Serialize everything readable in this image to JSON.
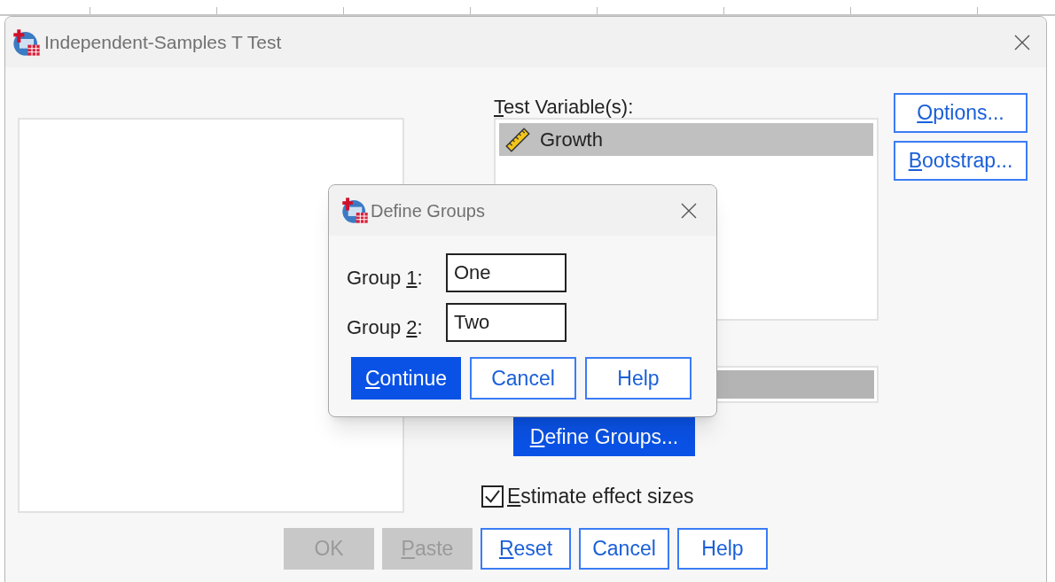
{
  "window": {
    "title": "Independent-Samples T Test"
  },
  "test_variables": {
    "label": {
      "key": "T",
      "post": "est Variable(s):"
    },
    "items": [
      {
        "name": "Growth",
        "selected": true
      }
    ]
  },
  "grouping_variable": {
    "selected": true
  },
  "define_groups_button": {
    "label": {
      "key": "D",
      "post": "efine Groups..."
    },
    "highlighted": true,
    "disabled": false
  },
  "side_buttons": [
    {
      "label": {
        "key": "O",
        "post": "ptions..."
      },
      "highlighted": false,
      "disabled": false
    },
    {
      "label": {
        "key": "B",
        "post": "ootstrap..."
      },
      "highlighted": false,
      "disabled": false
    }
  ],
  "effect_sizes": {
    "label": {
      "key": "E",
      "post": "stimate effect sizes"
    },
    "checked": true
  },
  "bottom_buttons": [
    {
      "label": {
        "pre": "OK"
      },
      "highlighted": false,
      "disabled": true
    },
    {
      "label": {
        "key": "P",
        "post": "aste"
      },
      "highlighted": false,
      "disabled": true
    },
    {
      "label": {
        "key": "R",
        "post": "eset"
      },
      "highlighted": false,
      "disabled": false
    },
    {
      "label": {
        "pre": "Cancel"
      },
      "highlighted": false,
      "disabled": false
    },
    {
      "label": {
        "pre": "Help"
      },
      "highlighted": false,
      "disabled": false
    }
  ],
  "dialog": {
    "title": "Define Groups",
    "fields": [
      {
        "label": {
          "pre": "Group ",
          "key": "1",
          "post": ":"
        },
        "value": "One"
      },
      {
        "label": {
          "pre": "Group ",
          "key": "2",
          "post": ":"
        },
        "value": "Two"
      }
    ],
    "buttons": [
      {
        "label": {
          "key": "C",
          "post": "ontinue"
        },
        "highlighted": true,
        "disabled": false
      },
      {
        "label": {
          "pre": "Cancel"
        },
        "highlighted": false,
        "disabled": false
      },
      {
        "label": {
          "pre": "Help"
        },
        "highlighted": false,
        "disabled": false
      }
    ]
  }
}
